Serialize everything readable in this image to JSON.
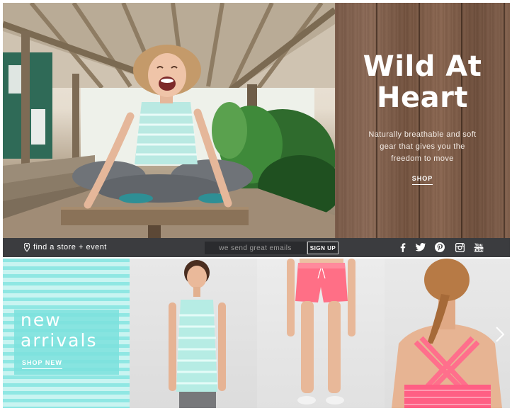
{
  "hero": {
    "title_line1": "Wild At",
    "title_line2": "Heart",
    "subtitle_line1": "Naturally breathable and soft",
    "subtitle_line2": "gear that gives you the",
    "subtitle_line3": "freedom to move",
    "shop_label": "SHOP"
  },
  "bar": {
    "store_link": "find a store + event",
    "email_placeholder": "we send great emails",
    "signup_label": "SIGN UP",
    "social_icons": [
      "facebook-icon",
      "twitter-icon",
      "pinterest-icon",
      "instagram-icon",
      "youtube-icon"
    ]
  },
  "new_arrivals": {
    "label": "new\narrivals",
    "shop_label": "SHOP NEW"
  },
  "colors": {
    "bar_background": "#3b3c3f",
    "mint": "#8fe7e3",
    "coral": "#ff6f86",
    "wood": "#7a5a48"
  }
}
